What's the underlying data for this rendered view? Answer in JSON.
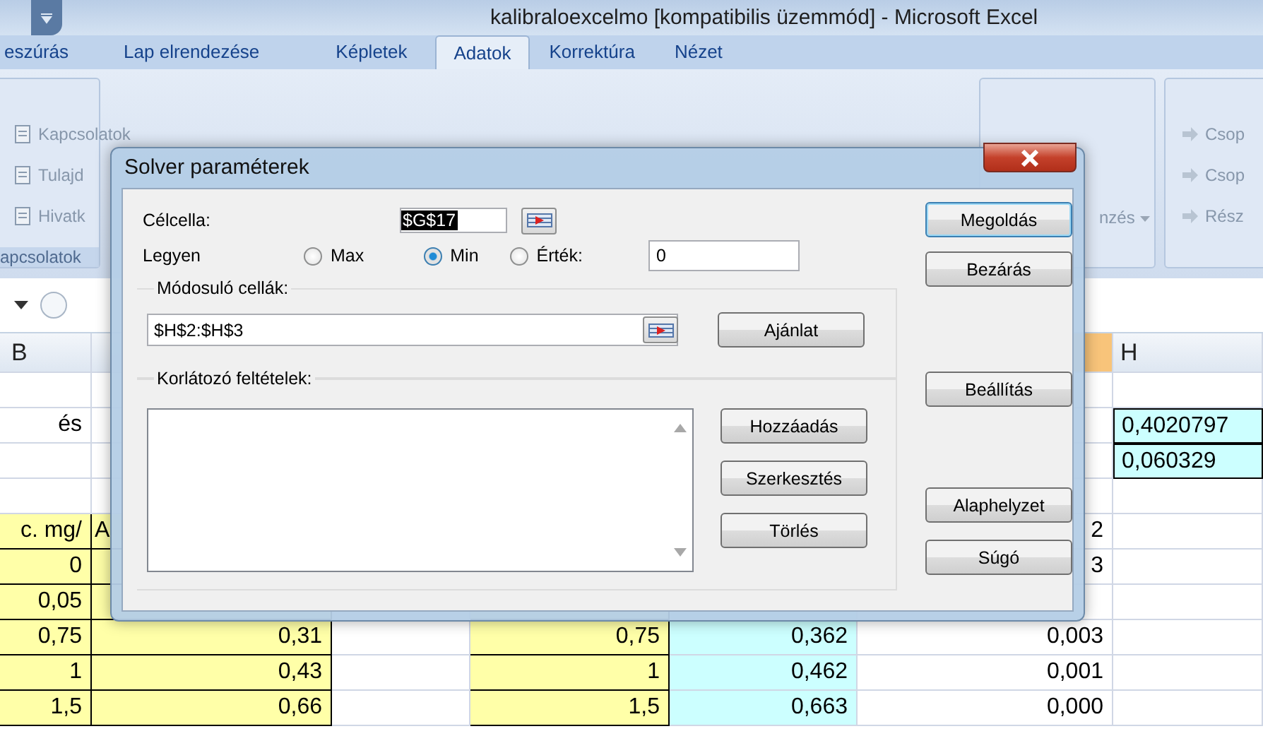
{
  "window": {
    "title": "kalibraloexcelmo  [kompatibilis üzemmód] - Microsoft Excel"
  },
  "ribbon_tabs": [
    {
      "label": "eszúrás",
      "selected": false
    },
    {
      "label": "Lap elrendezése",
      "selected": false
    },
    {
      "label": "Képletek",
      "selected": false
    },
    {
      "label": "Adatok",
      "selected": true
    },
    {
      "label": "Korrektúra",
      "selected": false
    },
    {
      "label": "Nézet",
      "selected": false
    }
  ],
  "ribbon_left": {
    "items": [
      "Kapcsolatok",
      "Tulajd",
      "Hivatk"
    ],
    "group_label": "apcsolatok"
  },
  "ribbon_right": {
    "dropdown": "nzés",
    "items": [
      "Csop",
      "Csop",
      "Rész"
    ]
  },
  "column_headers": [
    "B",
    "H"
  ],
  "rows": [
    {},
    {
      "column_1": "és",
      "column_7": "0,4020797"
    },
    {
      "column_7": "0,060329"
    },
    {},
    {
      "column_1": "c. mg/",
      "column_2": "A",
      "column_6": "2"
    },
    {
      "column_1": "0",
      "column_6": "3"
    },
    {
      "column_1": "0,05"
    },
    {
      "column_1": "0,75",
      "column_2": "0,31",
      "column_4": "0,75",
      "column_5": "0,362",
      "column_6": "0,003"
    },
    {
      "column_1": "1",
      "column_2": "0,43",
      "column_4": "1",
      "column_5": "0,462",
      "column_6": "0,001"
    },
    {
      "column_1": "1,5",
      "column_2": "0,66",
      "column_4": "1,5",
      "column_5": "0,663",
      "column_6": "0,000"
    }
  ],
  "dialog": {
    "title": "Solver paraméterek",
    "target_label": "Célcella:",
    "target_value": "$G$17",
    "equal_label": "Legyen",
    "options": [
      {
        "label": "Max",
        "selected": false
      },
      {
        "label": "Min",
        "selected": true
      },
      {
        "label": "Érték:",
        "selected": false
      }
    ],
    "value_field": "0",
    "changing_label": "Módosuló cellák:",
    "changing_value": "$H$2:$H$3",
    "guess_button": "Ajánlat",
    "constraints_label": "Korlátozó feltételek:",
    "constraint_buttons": [
      "Hozzáadás",
      "Szerkesztés",
      "Törlés"
    ],
    "side_buttons": [
      {
        "label": "Megoldás",
        "default": true
      },
      {
        "label": "Bezárás",
        "default": false
      },
      {
        "label": "Beállítás",
        "default": false
      },
      {
        "label": "Alaphelyzet",
        "default": false
      },
      {
        "label": "Súgó",
        "default": false
      }
    ]
  }
}
